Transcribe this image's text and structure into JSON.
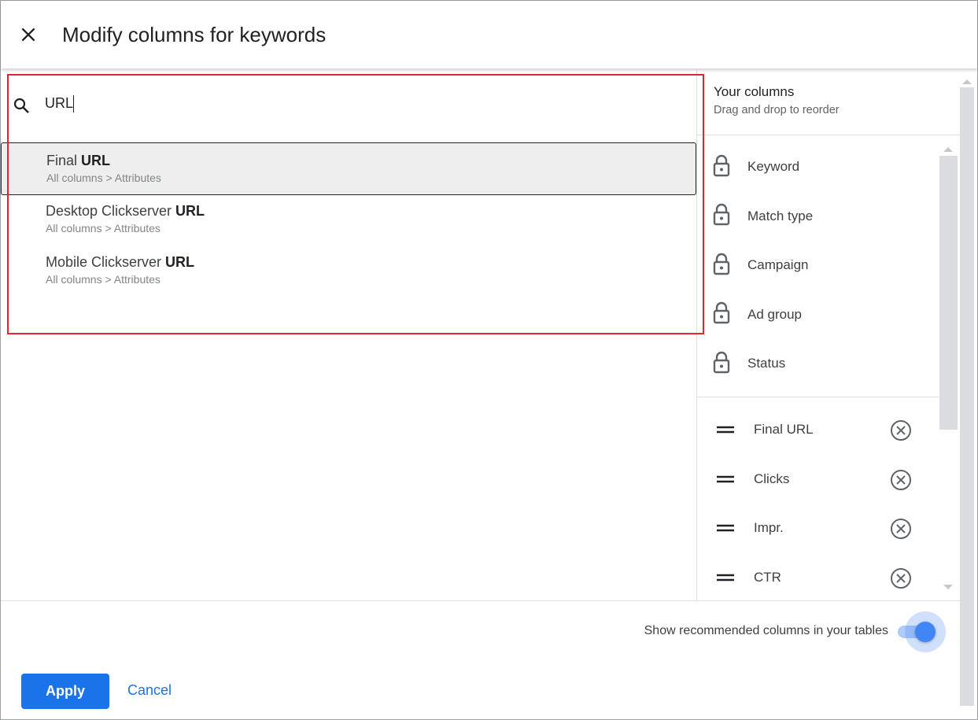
{
  "dialog": {
    "title": "Modify columns for keywords"
  },
  "search": {
    "value": "URL",
    "icon": "search-icon"
  },
  "results": [
    {
      "prefix": "Final ",
      "match": "URL",
      "path": "All columns > Attributes",
      "selected": true
    },
    {
      "prefix": "Desktop Clickserver ",
      "match": "URL",
      "path": "All columns > Attributes",
      "selected": false
    },
    {
      "prefix": "Mobile Clickserver ",
      "match": "URL",
      "path": "All columns > Attributes",
      "selected": false
    }
  ],
  "your_columns": {
    "title": "Your columns",
    "subtitle": "Drag and drop to reorder",
    "locked": [
      "Keyword",
      "Match type",
      "Campaign",
      "Ad group",
      "Status"
    ],
    "removable": [
      "Final URL",
      "Clicks",
      "Impr.",
      "CTR"
    ]
  },
  "footer": {
    "toggle_label": "Show recommended columns in your tables",
    "toggle_on": true,
    "apply": "Apply",
    "cancel": "Cancel"
  },
  "colors": {
    "accent": "#1a73e8",
    "toggle": "#4285f4",
    "highlight_box": "#e3262b"
  }
}
